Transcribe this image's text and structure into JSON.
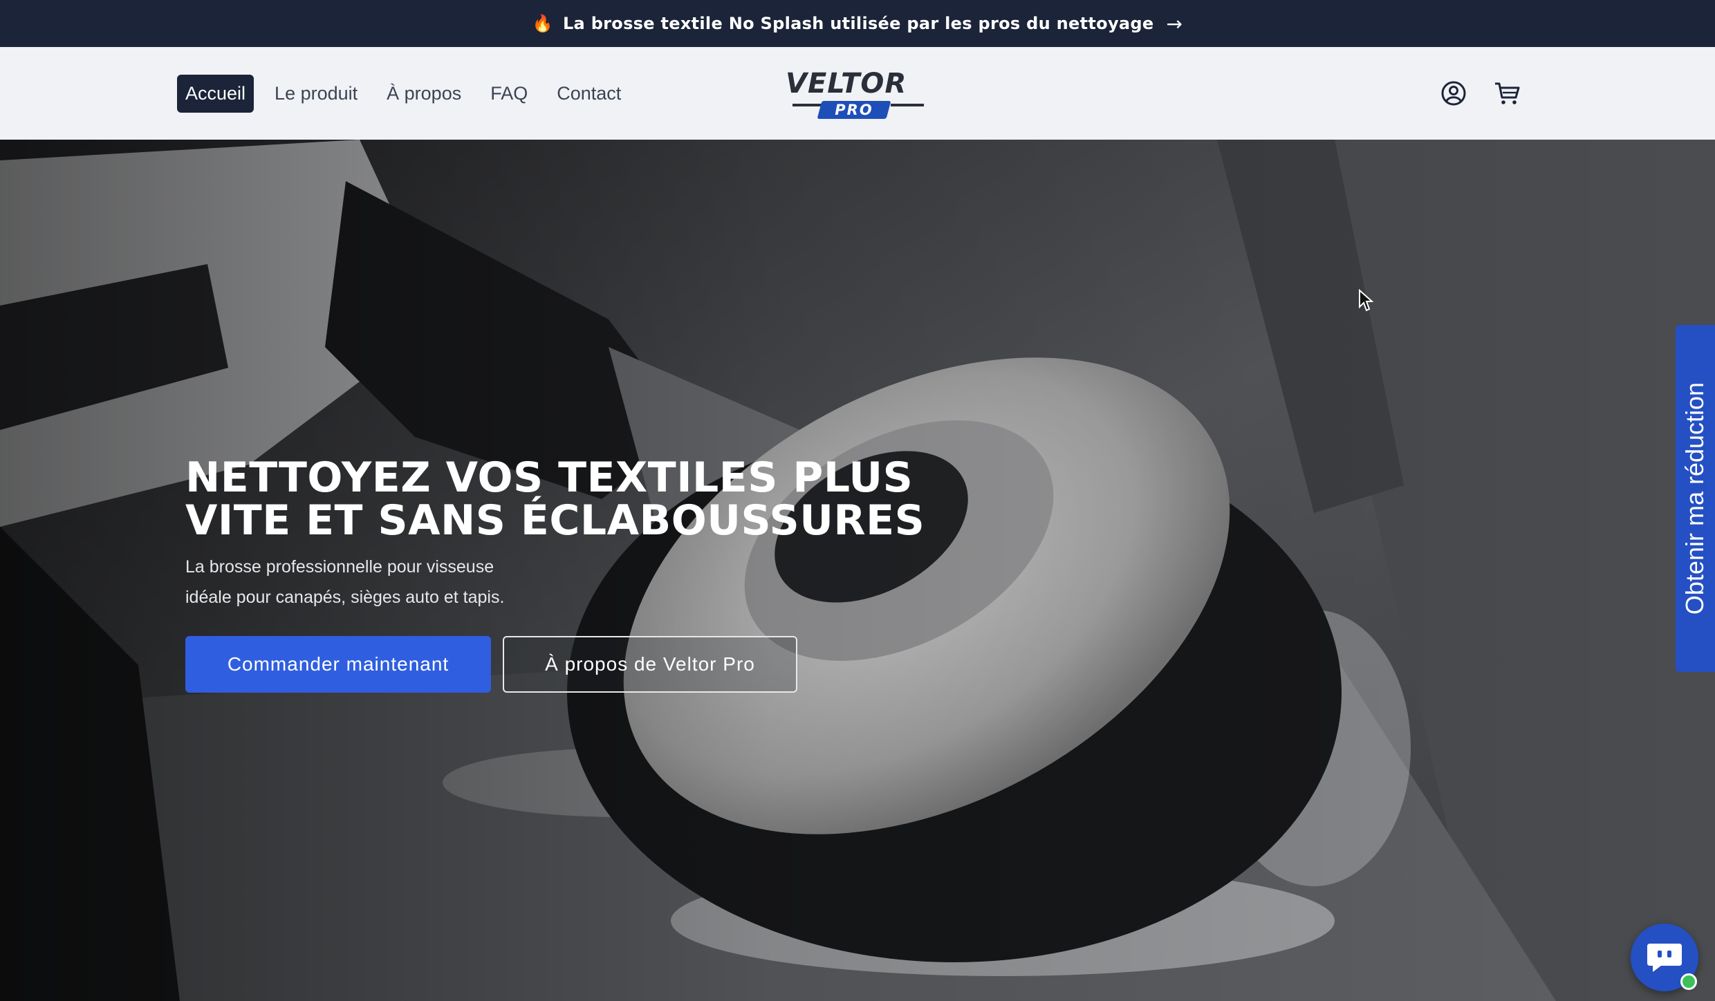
{
  "announcement": {
    "icon": "fire-icon",
    "text": "La brosse textile No Splash utilisée par les pros du nettoyage",
    "arrow": "→"
  },
  "nav": {
    "items": [
      {
        "label": "Accueil",
        "active": true
      },
      {
        "label": "Le produit"
      },
      {
        "label": "À propos"
      },
      {
        "label": "FAQ"
      },
      {
        "label": "Contact"
      }
    ]
  },
  "logo": {
    "brand": "VELTOR",
    "sub": "PRO"
  },
  "header_icons": [
    "account-icon",
    "cart-icon"
  ],
  "hero": {
    "title_line1": "NETTOYEZ VOS TEXTILES PLUS",
    "title_line2": "VITE ET SANS ÉCLABOUSSURES",
    "subtitle_line1": "La brosse professionnelle pour visseuse",
    "subtitle_line2": "idéale pour canapés, sièges auto et tapis.",
    "primary_button": "Commander maintenant",
    "secondary_button": "À propos de Veltor Pro"
  },
  "side_tab": {
    "label": "Obtenir ma réduction"
  },
  "chat": {
    "icon": "chat-icon",
    "online": true
  },
  "colors": {
    "announcement_bg": "#1b2438",
    "primary_button": "#2f5fe0",
    "side_tab": "#2450c4",
    "header_bg": "#f1f2f6"
  }
}
